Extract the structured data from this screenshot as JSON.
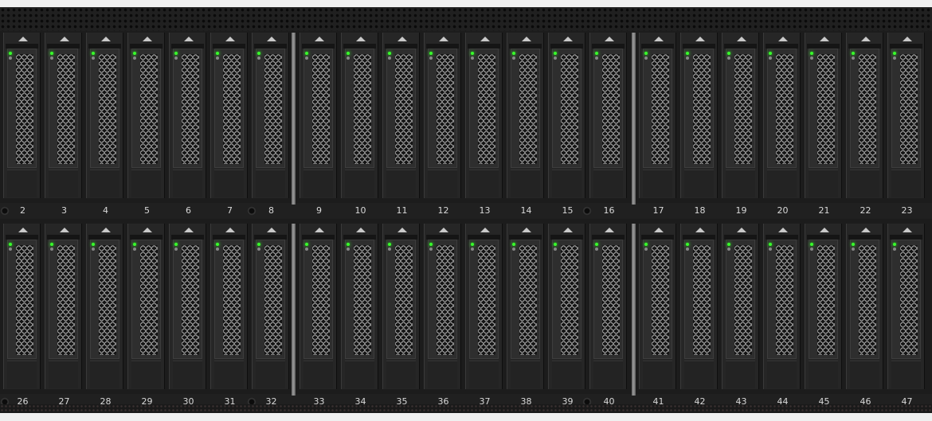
{
  "rows": [
    {
      "labels": [
        "2",
        "3",
        "4",
        "5",
        "6",
        "7",
        "8",
        "9",
        "10",
        "11",
        "12",
        "13",
        "14",
        "15",
        "16",
        "17",
        "18",
        "19",
        "20",
        "21",
        "22",
        "23"
      ]
    },
    {
      "labels": [
        "26",
        "27",
        "28",
        "29",
        "30",
        "31",
        "32",
        "33",
        "34",
        "35",
        "36",
        "37",
        "38",
        "39",
        "40",
        "41",
        "42",
        "43",
        "44",
        "45",
        "46",
        "47"
      ]
    }
  ],
  "colors": {
    "led_active": "#38ff2a",
    "chassis": "#1c1c1c",
    "label_text": "#d8d8d8"
  }
}
